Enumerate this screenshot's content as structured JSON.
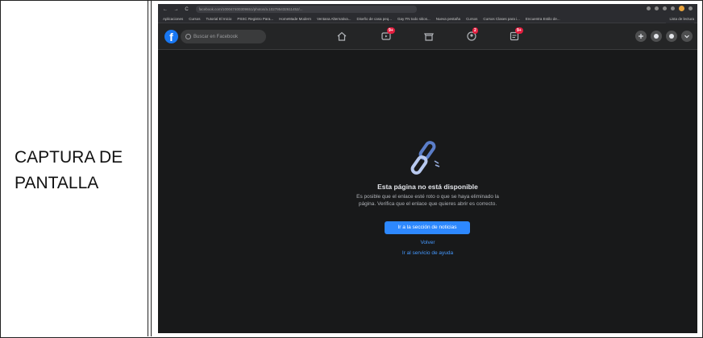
{
  "doc": {
    "left_label_line1": "CAPTURA DE",
    "left_label_line2": "PANTALLA"
  },
  "browser": {
    "nav_buttons": "←  →  C",
    "url": "facebook.com/100047400309651/photos/a.102795432611452/...",
    "bookmarks": [
      "Aplicaciones",
      "Cursos",
      "Tutorial El Inicio",
      "PSSC Registro Para...",
      "HomeMade Modern",
      "Ventana Alternativa...",
      "Diseño de casa peq...",
      "Gay FN todo sitios...",
      "Nueva pestaña",
      "Cursos",
      "Cursos Clases para i...",
      "Encuentra Estilo de..."
    ],
    "reading_list": "Lista de lectura"
  },
  "facebook": {
    "logo": "f",
    "search_placeholder": "Buscar en Facebook",
    "badges": {
      "watch": "9+",
      "groups": "2",
      "gaming": "9+"
    },
    "accent": "#2d88ff",
    "brand": "#1877f2"
  },
  "error": {
    "title": "Esta página no está disponible",
    "body": "Es posible que el enlace esté roto o que se haya eliminado la página. Verifica que el enlace que quieres abrir es correcto.",
    "primary_button": "Ir a la sección de noticias",
    "back_link": "Volver",
    "help_link": "Ir al servicio de ayuda"
  }
}
